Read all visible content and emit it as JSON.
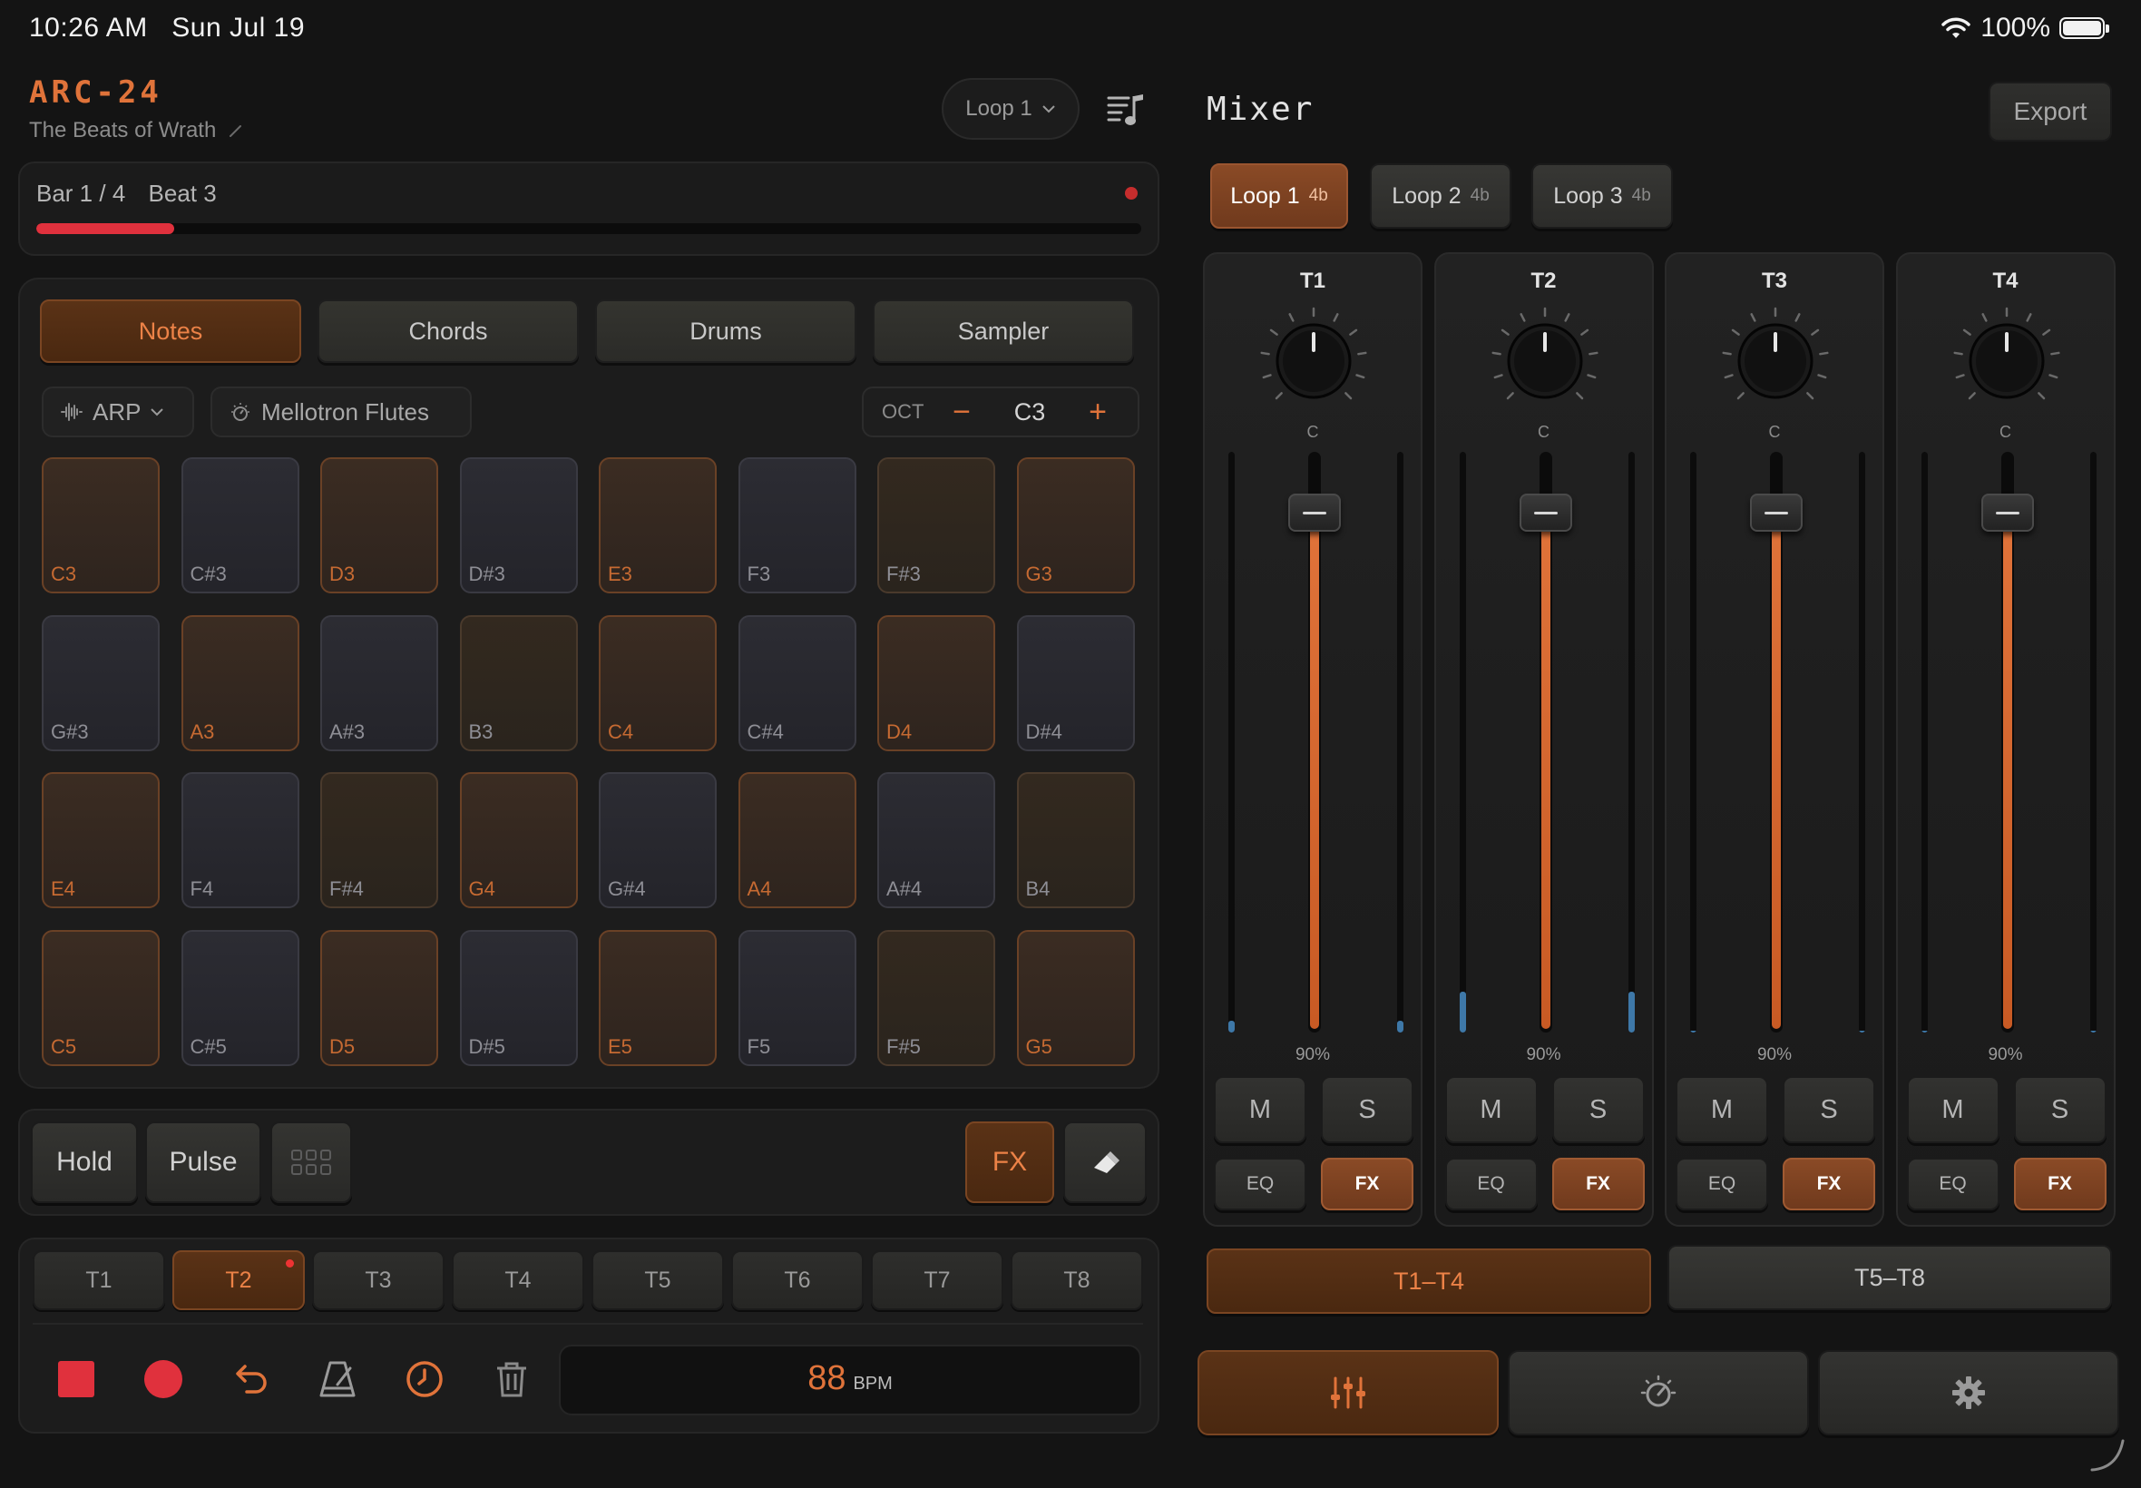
{
  "status": {
    "time": "10:26 AM",
    "date": "Sun Jul 19",
    "battery": "100%"
  },
  "header": {
    "app_title": "ARC-24",
    "project_name": "The Beats of Wrath",
    "loop_select": "Loop 1"
  },
  "position": {
    "bar": "Bar 1 / 4",
    "beat": "Beat 3",
    "progress": 0.125
  },
  "modes": [
    {
      "label": "Notes",
      "active": true
    },
    {
      "label": "Chords",
      "active": false
    },
    {
      "label": "Drums",
      "active": false
    },
    {
      "label": "Sampler",
      "active": false
    }
  ],
  "controls": {
    "arp_label": "ARP",
    "instrument": "Mellotron Flutes",
    "oct_label": "OCT",
    "oct_value": "C3",
    "oct_minus": "−",
    "oct_plus": "+"
  },
  "pads": [
    [
      "C3",
      "C#3",
      "D3",
      "D#3",
      "E3",
      "F3",
      "F#3",
      "G3"
    ],
    [
      "G#3",
      "A3",
      "A#3",
      "B3",
      "C4",
      "C#4",
      "D4",
      "D#4"
    ],
    [
      "E4",
      "F4",
      "F#4",
      "G4",
      "G#4",
      "A4",
      "A#4",
      "B4"
    ],
    [
      "C5",
      "C#5",
      "D5",
      "D#5",
      "E5",
      "F5",
      "F#5",
      "G5"
    ]
  ],
  "actions": {
    "hold": "Hold",
    "pulse": "Pulse",
    "fx": "FX"
  },
  "tracks": [
    {
      "label": "T1",
      "active": false
    },
    {
      "label": "T2",
      "active": true
    },
    {
      "label": "T3",
      "active": false
    },
    {
      "label": "T4",
      "active": false
    },
    {
      "label": "T5",
      "active": false
    },
    {
      "label": "T6",
      "active": false
    },
    {
      "label": "T7",
      "active": false
    },
    {
      "label": "T8",
      "active": false
    }
  ],
  "transport": {
    "bpm": "88",
    "bpm_unit": "BPM"
  },
  "mixer": {
    "title": "Mixer",
    "export_label": "Export",
    "loops": [
      {
        "label": "Loop 1",
        "beats": "4b",
        "active": true
      },
      {
        "label": "Loop 2",
        "beats": "4b",
        "active": false
      },
      {
        "label": "Loop 3",
        "beats": "4b",
        "active": false
      }
    ],
    "channels": [
      {
        "name": "T1",
        "pan": "C",
        "volume": "90%",
        "level": 0.9,
        "meter": 0.02,
        "mute": "M",
        "solo": "S",
        "eq": "EQ",
        "fx": "FX"
      },
      {
        "name": "T2",
        "pan": "C",
        "volume": "90%",
        "level": 0.9,
        "meter": 0.07,
        "mute": "M",
        "solo": "S",
        "eq": "EQ",
        "fx": "FX"
      },
      {
        "name": "T3",
        "pan": "C",
        "volume": "90%",
        "level": 0.9,
        "meter": 0.0,
        "mute": "M",
        "solo": "S",
        "eq": "EQ",
        "fx": "FX"
      },
      {
        "name": "T4",
        "pan": "C",
        "volume": "90%",
        "level": 0.9,
        "meter": 0.0,
        "mute": "M",
        "solo": "S",
        "eq": "EQ",
        "fx": "FX"
      }
    ],
    "banks": [
      {
        "label": "T1–T4",
        "active": true
      },
      {
        "label": "T5–T8",
        "active": false
      }
    ]
  },
  "colors": {
    "accent": "#e0733a",
    "record": "#e0313d",
    "background": "#141414"
  },
  "icons": {
    "loop_chevron": "chevron-down-icon",
    "sequence": "music-sequence-icon",
    "arp": "waveform-icon",
    "instrument": "dial-icon",
    "grid": "grid-icon",
    "eraser": "eraser-icon",
    "stop": "stop-icon",
    "record": "record-icon",
    "undo": "undo-icon",
    "metronome": "metronome-icon",
    "clock": "clock-icon",
    "trash": "trash-icon",
    "nav_mixer": "sliders-icon",
    "nav_dial": "dial-icon",
    "nav_settings": "gear-icon"
  }
}
